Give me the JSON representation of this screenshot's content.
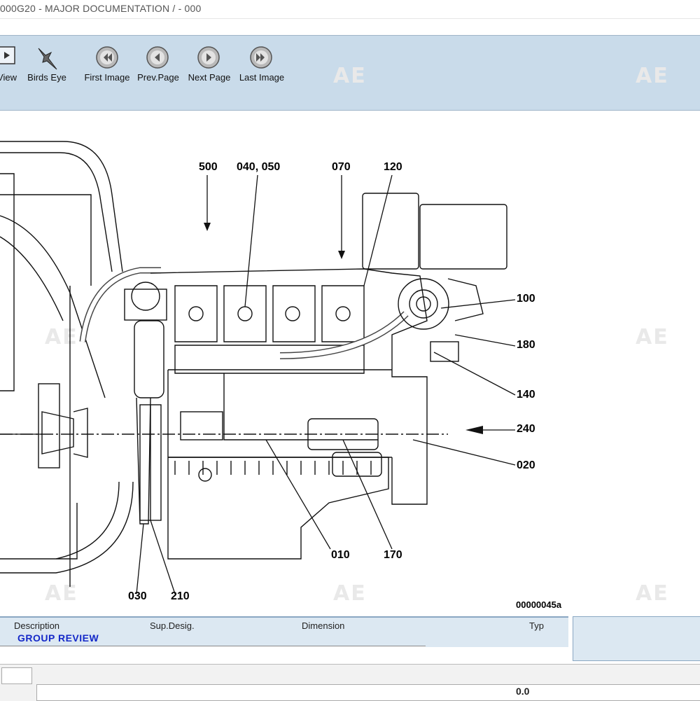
{
  "window": {
    "title": "000G20 - MAJOR DOCUMENTATION / - 000"
  },
  "toolbar": {
    "buttons": [
      {
        "label": "View",
        "icon": "view-icon"
      },
      {
        "label": "Birds Eye",
        "icon": "bird-icon"
      },
      {
        "label": "First Image",
        "icon": "first-icon"
      },
      {
        "label": "Prev.Page",
        "icon": "prev-icon"
      },
      {
        "label": "Next Page",
        "icon": "next-icon"
      },
      {
        "label": "Last Image",
        "icon": "last-icon"
      }
    ]
  },
  "drawing": {
    "callouts": [
      "500",
      "040, 050",
      "070",
      "120",
      "100",
      "180",
      "140",
      "240",
      "020",
      "010",
      "170",
      "030",
      "210"
    ],
    "drawing_id": "00000045a",
    "watermark": "AE"
  },
  "detail": {
    "columns": {
      "description": "Description",
      "sup_desig": "Sup.Desig.",
      "dimension": "Dimension",
      "typ": "Typ"
    },
    "group_label": "GROUP REVIEW"
  },
  "status": {
    "coords": "0.0"
  },
  "colors": {
    "toolbar_bg": "#c9dbea",
    "group_text": "#1428c8"
  }
}
